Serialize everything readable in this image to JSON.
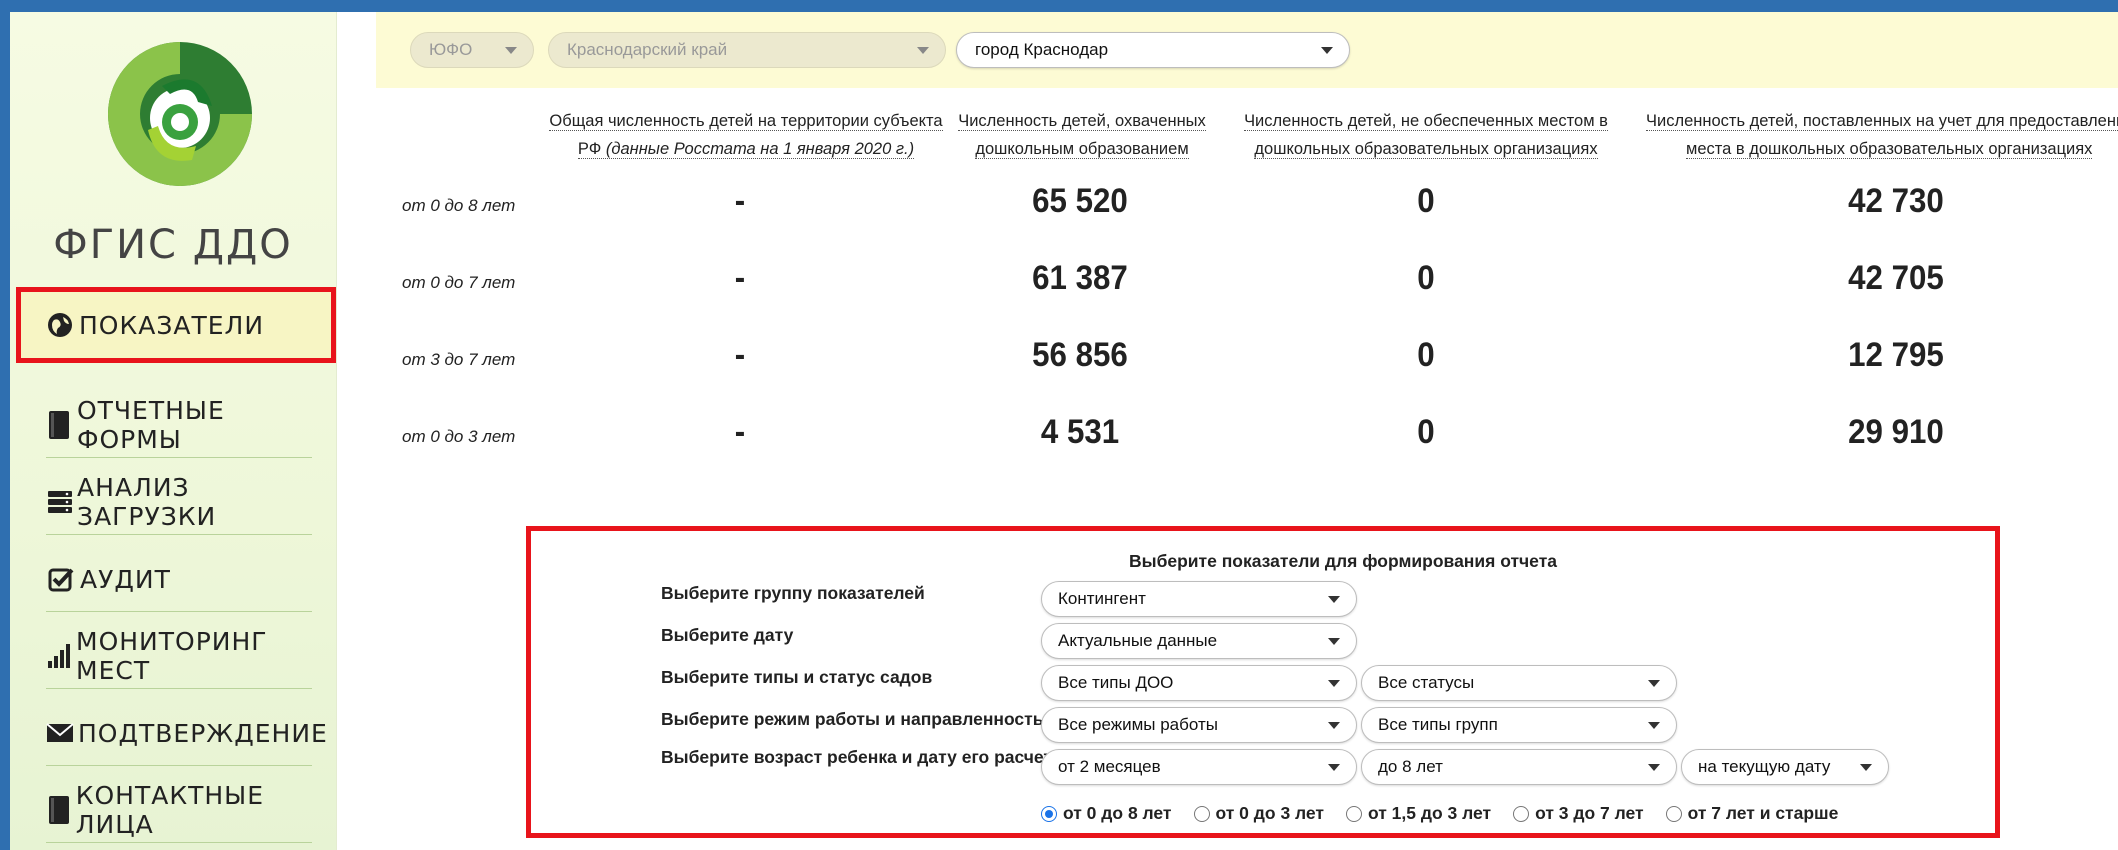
{
  "brand": {
    "title": "ФГИС ДДО"
  },
  "sidebar": {
    "items": [
      {
        "label": "ПОКАЗАТЕЛИ",
        "icon": "globe-icon",
        "active": true
      },
      {
        "label": "ОТЧЕТНЫЕ ФОРМЫ",
        "icon": "book-icon"
      },
      {
        "label": "АНАЛИЗ ЗАГРУЗКИ",
        "icon": "server-icon"
      },
      {
        "label": "АУДИТ",
        "icon": "check-square-icon"
      },
      {
        "label": "МОНИТОРИНГ МЕСТ",
        "icon": "signal-bars-icon"
      },
      {
        "label": "ПОДТВЕРЖДЕНИЕ",
        "icon": "envelope-icon"
      },
      {
        "label": "КОНТАКТНЫЕ ЛИЦА",
        "icon": "book-icon"
      }
    ]
  },
  "filters": {
    "district": "ЮФО",
    "region": "Краснодарский край",
    "city": "город Краснодар"
  },
  "table": {
    "headers": [
      {
        "line1": "Общая численность детей на территории субъекта",
        "line2_plain": "РФ ",
        "line2_italic": "(данные Росстата на 1 января 2020 г.)"
      },
      {
        "line1": "Численность детей, охваченных",
        "line2": "дошкольным образованием"
      },
      {
        "line1": "Численность детей, не обеспеченных местом в",
        "line2": "дошкольных образовательных организациях"
      },
      {
        "line1": "Численность детей, поставленных на учет для предоставления",
        "line2": "места в дошкольных образовательных организациях"
      }
    ],
    "rows": [
      {
        "label": "от 0 до 8 лет",
        "c1": "-",
        "c2": "65 520",
        "c3": "0",
        "c4": "42 730"
      },
      {
        "label": "от 0 до 7 лет",
        "c1": "-",
        "c2": "61 387",
        "c3": "0",
        "c4": "42 705"
      },
      {
        "label": "от 3 до 7 лет",
        "c1": "-",
        "c2": "56 856",
        "c3": "0",
        "c4": "12 795"
      },
      {
        "label": "от 0 до 3 лет",
        "c1": "-",
        "c2": "4 531",
        "c3": "0",
        "c4": "29 910"
      }
    ]
  },
  "report": {
    "title": "Выберите показатели для формирования отчета",
    "labels": {
      "group": "Выберите группу показателей",
      "date": "Выберите дату",
      "types": "Выберите типы и статус садов",
      "mode": "Выберите режим работы и направленность",
      "age": "Выберите возраст ребенка и дату его расчета"
    },
    "selects": {
      "group": "Контингент",
      "date": "Актуальные данные",
      "types": "Все типы ДОО",
      "status": "Все статусы",
      "mode": "Все режимы работы",
      "groups": "Все типы групп",
      "age_from": "от 2 месяцев",
      "age_to": "до 8 лет",
      "age_date": "на текущую дату"
    },
    "radios": [
      {
        "label": "от 0 до 8 лет",
        "checked": true
      },
      {
        "label": "от 0 до 3 лет",
        "checked": false
      },
      {
        "label": "от 1,5 до 3 лет",
        "checked": false
      },
      {
        "label": "от 3 до 7 лет",
        "checked": false
      },
      {
        "label": "от 7 лет и старше",
        "checked": false
      }
    ]
  },
  "colors": {
    "accent_red": "#e8141b",
    "logo_green": "#3a8f2e",
    "logo_lime": "#9ccc2a"
  }
}
